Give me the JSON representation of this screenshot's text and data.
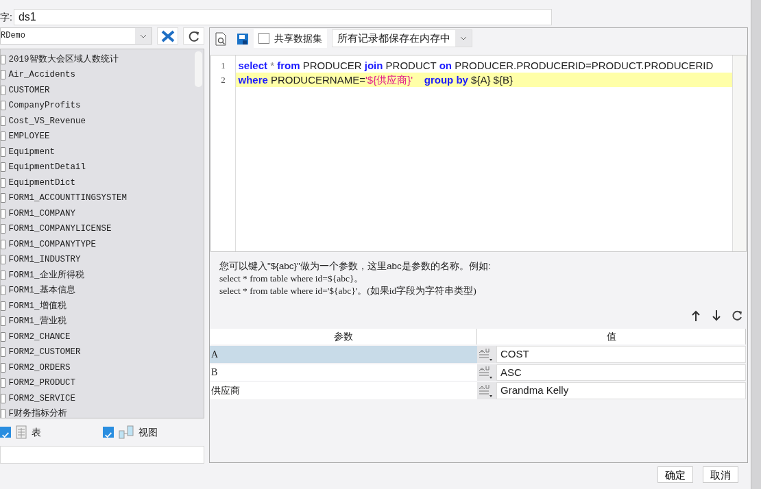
{
  "name_field": {
    "label": "字:",
    "value": "ds1"
  },
  "connection": {
    "value": "RDemo"
  },
  "tables": [
    {
      "name": "2019智数大会区域人数统计"
    },
    {
      "name": "Air_Accidents"
    },
    {
      "name": "CUSTOMER"
    },
    {
      "name": "CompanyProfits"
    },
    {
      "name": "Cost_VS_Revenue"
    },
    {
      "name": "EMPLOYEE"
    },
    {
      "name": "Equipment"
    },
    {
      "name": "EquipmentDetail"
    },
    {
      "name": "EquipmentDict"
    },
    {
      "name": "FORM1_ACCOUNTTINGSYSTEM"
    },
    {
      "name": "FORM1_COMPANY"
    },
    {
      "name": "FORM1_COMPANYLICENSE"
    },
    {
      "name": "FORM1_COMPANYTYPE"
    },
    {
      "name": "FORM1_INDUSTRY"
    },
    {
      "name": "FORM1_企业所得税"
    },
    {
      "name": "FORM1_基本信息"
    },
    {
      "name": "FORM1_增值税"
    },
    {
      "name": "FORM1_营业税"
    },
    {
      "name": "FORM2_CHANCE"
    },
    {
      "name": "FORM2_CUSTOMER"
    },
    {
      "name": "FORM2_ORDERS"
    },
    {
      "name": "FORM2_PRODUCT"
    },
    {
      "name": "FORM2_SERVICE"
    },
    {
      "name": "F财务指标分析"
    }
  ],
  "filters": [
    {
      "label": "表",
      "kind": "table",
      "checked": true
    },
    {
      "label": "视图",
      "kind": "view",
      "checked": true
    }
  ],
  "toolbar": {
    "shared": {
      "label": "共享数据集",
      "checked": false
    },
    "storage": "所有记录都保存在内存中"
  },
  "editor": {
    "lines": [
      {
        "number": "1",
        "current": false,
        "tokens": [
          {
            "kind": "keyword",
            "text": "select"
          },
          {
            "kind": "op",
            "text": " * "
          },
          {
            "kind": "keyword",
            "text": "from"
          },
          {
            "kind": "plain",
            "text": " PRODUCER "
          },
          {
            "kind": "keyword",
            "text": "join"
          },
          {
            "kind": "plain",
            "text": " PRODUCT "
          },
          {
            "kind": "keyword",
            "text": "on"
          },
          {
            "kind": "plain",
            "text": " PRODUCER.PRODUCERID=PRODUCT.PRODUCERID"
          }
        ]
      },
      {
        "number": "2",
        "current": true,
        "tokens": [
          {
            "kind": "keyword",
            "text": "where"
          },
          {
            "kind": "plain",
            "text": " PRODUCERNAME="
          },
          {
            "kind": "string",
            "text": "'${供应商}'"
          },
          {
            "kind": "keyword",
            "text": "    group by"
          },
          {
            "kind": "plain",
            "text": " ${A} ${B}"
          }
        ]
      }
    ]
  },
  "hint": [
    "您可以键入\"${abc}\"做为一个参数，这里abc是参数的名称。例如:",
    "select * from table where id=${abc}。",
    "select * from table where id='${abc}'。(如果id字段为字符串类型)"
  ],
  "params": {
    "columns": [
      "参数",
      "值"
    ],
    "rows": [
      {
        "name": "A",
        "value": "COST",
        "selected": true
      },
      {
        "name": "B",
        "value": "ASC",
        "selected": false
      },
      {
        "name": "供应商",
        "value": "Grandma Kelly",
        "selected": false
      }
    ]
  },
  "buttons": [
    "确定",
    "取消"
  ]
}
